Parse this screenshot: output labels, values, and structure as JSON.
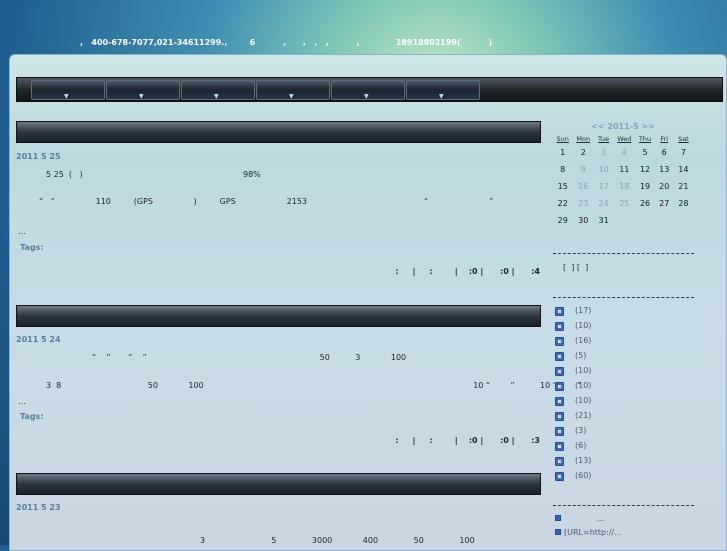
{
  "header": {
    "contact": ",   400-678-7077,021-34611299.,        6          ,      ,   ,   ,          ,             18918802199(          )"
  },
  "nav": {
    "items": [
      "",
      "",
      "",
      "",
      "",
      ""
    ],
    "arrow": "▼"
  },
  "posts": [
    {
      "date": "2011  5  25",
      "lines": [
        "5 25  (   )                                                               98%",
        "“   ”                110         (GPS                )         GPS                    2153                                              “                        ”",
        "…"
      ],
      "tags_label": "Tags:",
      "meta": ":     |     :        |    :0 |      :0 |      :4"
    },
    {
      "date": "2011  5  24",
      "lines": [
        "“    ”       “    ”                                                                    50          3            100",
        "3  8                                  50            100                                                                                                          10 “        ”          10 “        ”",
        "…"
      ],
      "tags_label": "Tags:",
      "meta": ":     |     :        |    :0 |      :0 |      :3"
    },
    {
      "date": "2011  5  23",
      "lines": [
        "3                          5              3000            400              50              100"
      ]
    }
  ],
  "calendar": {
    "title": "<< 2011-5 >>",
    "days": [
      "Sun",
      "Mon",
      "Tue",
      "Wed",
      "Thu",
      "Fri",
      "Sat"
    ],
    "weeks": [
      [
        "1",
        "2",
        "3",
        "4",
        "5",
        "6",
        "7"
      ],
      [
        "8",
        "9",
        "10",
        "11",
        "12",
        "13",
        "14"
      ],
      [
        "15",
        "16",
        "17",
        "18",
        "19",
        "20",
        "21"
      ],
      [
        "22",
        "23",
        "24",
        "25",
        "26",
        "27",
        "28"
      ],
      [
        "29",
        "30",
        "31",
        "",
        "",
        "",
        ""
      ]
    ],
    "faded": [
      "3",
      "4",
      "9",
      "10",
      "16",
      "17",
      "18",
      "23",
      "24",
      "25"
    ]
  },
  "sidebar_links": "[  ] [  ]",
  "categories": [
    {
      "count": "(17)"
    },
    {
      "count": "(10)"
    },
    {
      "count": "(16)"
    },
    {
      "count": "(5)"
    },
    {
      "count": "(10)"
    },
    {
      "count": "(10)"
    },
    {
      "count": "(10)"
    },
    {
      "count": "(21)"
    },
    {
      "count": "(3)"
    },
    {
      "count": "(6)"
    },
    {
      "count": "(13)"
    },
    {
      "count": "(60)"
    }
  ],
  "recent": [
    {
      "text": "…"
    },
    {
      "text": "[URL=http://..."
    }
  ]
}
